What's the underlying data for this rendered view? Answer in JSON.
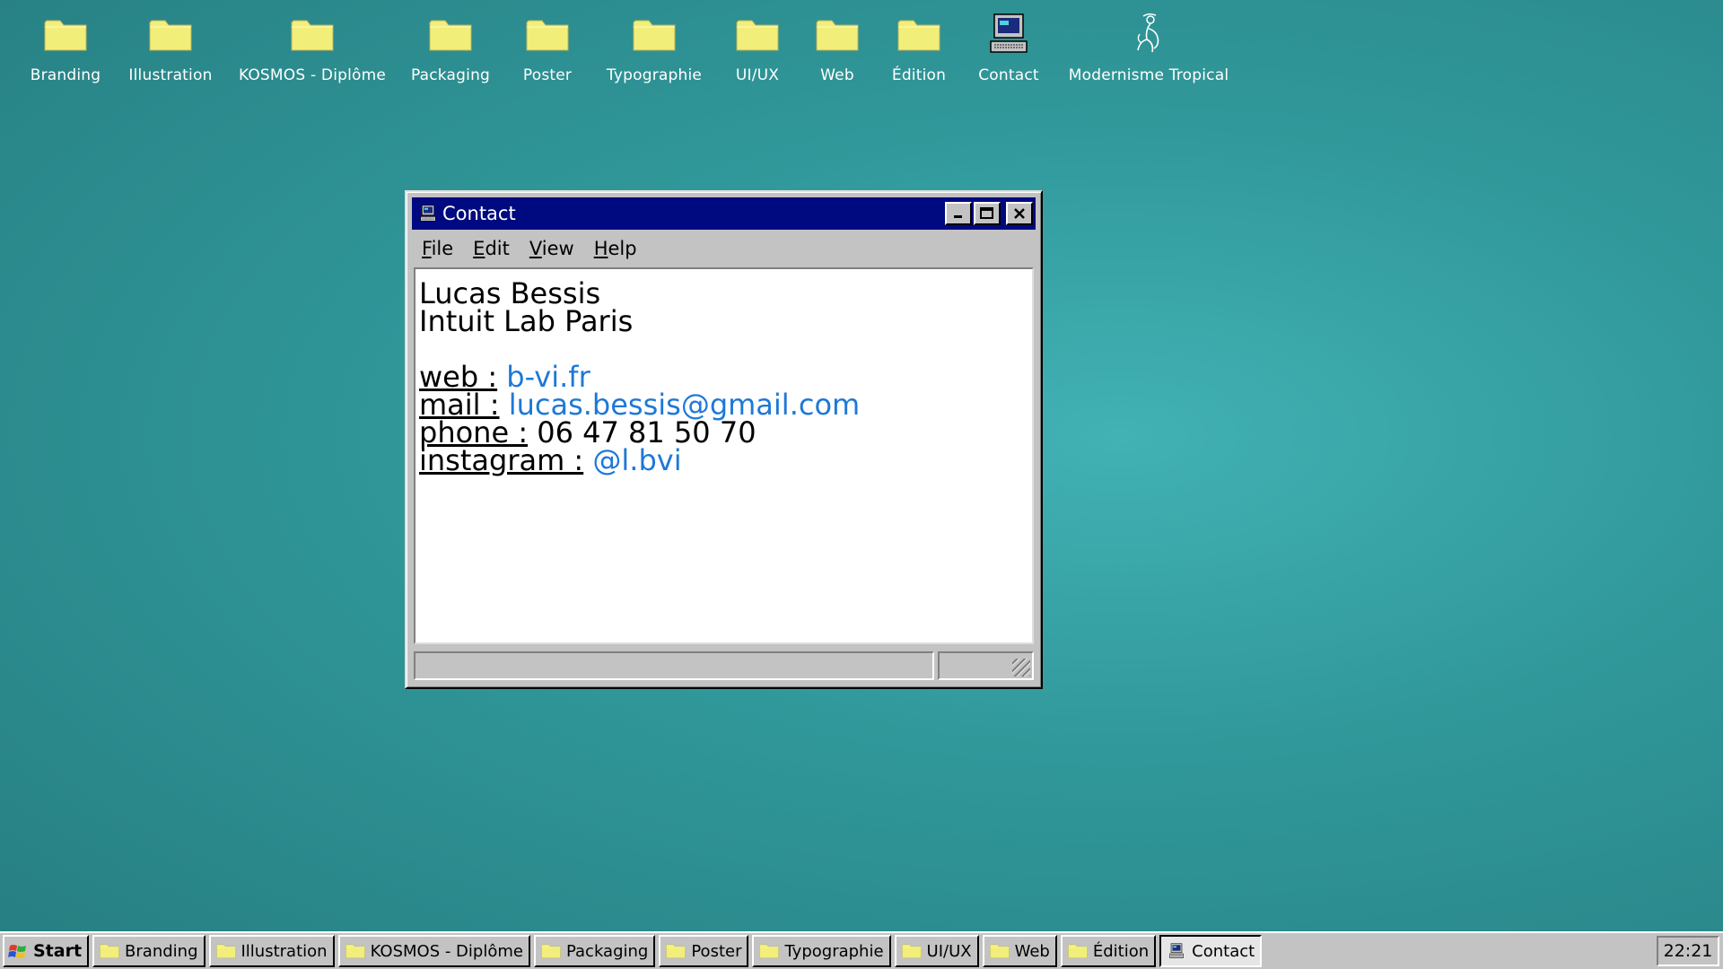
{
  "desktop": {
    "icons": [
      {
        "label": "Branding",
        "icon": "folder-icon"
      },
      {
        "label": "Illustration",
        "icon": "folder-icon"
      },
      {
        "label": "KOSMOS - Diplôme",
        "icon": "folder-icon"
      },
      {
        "label": "Packaging",
        "icon": "folder-icon"
      },
      {
        "label": "Poster",
        "icon": "folder-icon"
      },
      {
        "label": "Typographie",
        "icon": "folder-icon"
      },
      {
        "label": "UI/UX",
        "icon": "folder-icon"
      },
      {
        "label": "Web",
        "icon": "folder-icon"
      },
      {
        "label": "Édition",
        "icon": "folder-icon"
      },
      {
        "label": "Contact",
        "icon": "computer-icon"
      },
      {
        "label": "Modernisme Tropical",
        "icon": "tropical-figure-icon"
      }
    ]
  },
  "window": {
    "title": "Contact",
    "menu": [
      {
        "label": "File",
        "accel": "F",
        "rest": "ile"
      },
      {
        "label": "Edit",
        "accel": "E",
        "rest": "dit"
      },
      {
        "label": "View",
        "accel": "V",
        "rest": "iew"
      },
      {
        "label": "Help",
        "accel": "H",
        "rest": "elp"
      }
    ],
    "content": {
      "name": "Lucas Bessis",
      "company": "Intuit Lab Paris",
      "web_label": "web :",
      "web_value": "b-vi.fr",
      "mail_label": "mail :",
      "mail_value": "lucas.bessis@gmail.com",
      "phone_label": "phone :",
      "phone_value": "06 47 81 50 70",
      "instagram_label": "instagram :",
      "instagram_value": "@l.bvi"
    }
  },
  "taskbar": {
    "start_label": "Start",
    "buttons": [
      {
        "label": "Branding",
        "icon": "folder-icon"
      },
      {
        "label": "Illustration",
        "icon": "folder-icon"
      },
      {
        "label": "KOSMOS - Diplôme",
        "icon": "folder-icon"
      },
      {
        "label": "Packaging",
        "icon": "folder-icon"
      },
      {
        "label": "Poster",
        "icon": "folder-icon"
      },
      {
        "label": "Typographie",
        "icon": "folder-icon"
      },
      {
        "label": "UI/UX",
        "icon": "folder-icon"
      },
      {
        "label": "Web",
        "icon": "folder-icon"
      },
      {
        "label": "Édition",
        "icon": "folder-icon"
      },
      {
        "label": "Contact",
        "icon": "computer-icon",
        "active": true
      }
    ],
    "clock": "22:21"
  },
  "colors": {
    "desktop": "#31999b",
    "titlebar": "#000a80",
    "link": "#1e78d8",
    "folder": "#f2ee7a"
  }
}
